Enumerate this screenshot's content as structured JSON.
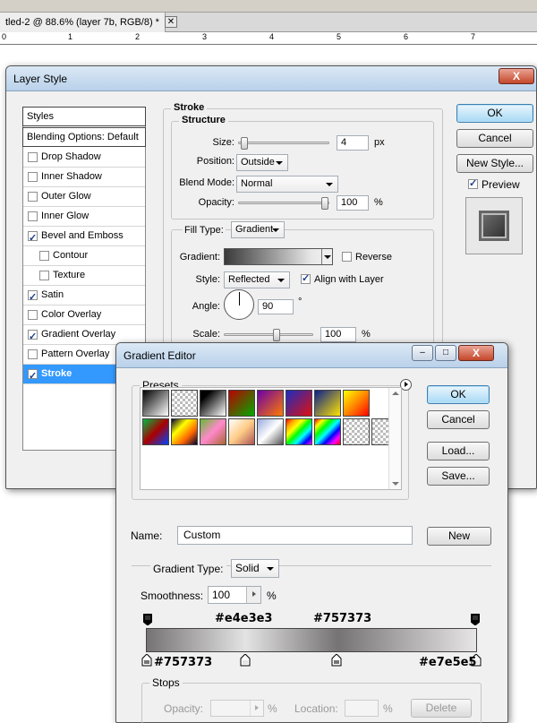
{
  "document": {
    "tab_title": "tled-2 @ 88.6% (layer 7b, RGB/8) *",
    "close_glyph": "✕",
    "ruler_numbers": [
      "0",
      "1",
      "2",
      "3",
      "4",
      "5",
      "6",
      "7"
    ]
  },
  "layer_style": {
    "title": "Layer Style",
    "close_glyph": "X",
    "styles_header": "Styles",
    "blending_options": "Blending Options: Default",
    "items": [
      {
        "label": "Drop Shadow",
        "checked": false,
        "indent": false
      },
      {
        "label": "Inner Shadow",
        "checked": false,
        "indent": false
      },
      {
        "label": "Outer Glow",
        "checked": false,
        "indent": false
      },
      {
        "label": "Inner Glow",
        "checked": false,
        "indent": false
      },
      {
        "label": "Bevel and Emboss",
        "checked": true,
        "indent": false
      },
      {
        "label": "Contour",
        "checked": false,
        "indent": true
      },
      {
        "label": "Texture",
        "checked": false,
        "indent": true
      },
      {
        "label": "Satin",
        "checked": true,
        "indent": false
      },
      {
        "label": "Color Overlay",
        "checked": false,
        "indent": false
      },
      {
        "label": "Gradient Overlay",
        "checked": true,
        "indent": false
      },
      {
        "label": "Pattern Overlay",
        "checked": false,
        "indent": false
      },
      {
        "label": "Stroke",
        "checked": true,
        "indent": false,
        "selected": true
      }
    ],
    "stroke": {
      "section_title": "Stroke",
      "structure_title": "Structure",
      "size_label": "Size:",
      "size_value": "4",
      "size_unit": "px",
      "size_fraction": 0.02,
      "position_label": "Position:",
      "position_value": "Outside",
      "blend_label": "Blend Mode:",
      "blend_value": "Normal",
      "opacity_label": "Opacity:",
      "opacity_value": "100",
      "opacity_unit": "%",
      "opacity_fraction": 1.0,
      "fill_type_label": "Fill Type:",
      "fill_type_value": "Gradient",
      "gradient_label": "Gradient:",
      "reverse_label": "Reverse",
      "reverse_checked": false,
      "style_label": "Style:",
      "style_value": "Reflected",
      "align_label": "Align with Layer",
      "align_checked": true,
      "angle_label": "Angle:",
      "angle_value": "90",
      "angle_unit": "°",
      "scale_label": "Scale:",
      "scale_value": "100",
      "scale_unit": "%",
      "scale_fraction": 0.6
    },
    "buttons": {
      "ok": "OK",
      "cancel": "Cancel",
      "new_style": "New Style...",
      "preview_label": "Preview",
      "preview_checked": true
    }
  },
  "gradient_editor": {
    "title": "Gradient Editor",
    "presets_label": "Presets",
    "buttons": {
      "ok": "OK",
      "cancel": "Cancel",
      "load": "Load...",
      "save": "Save...",
      "new": "New",
      "delete": "Delete"
    },
    "name_label": "Name:",
    "name_value": "Custom",
    "gradient_type_label": "Gradient Type:",
    "gradient_type_value": "Solid",
    "smoothness_label": "Smoothness:",
    "smoothness_value": "100",
    "smoothness_unit": "%",
    "stop_labels": {
      "top_left": "#e4e3e3",
      "top_right": "#757373",
      "bottom_left": "#757373",
      "bottom_right": "#e7e5e5"
    },
    "stops_title": "Stops",
    "opacity_label": "Opacity:",
    "opacity_unit": "%",
    "location_label": "Location:",
    "location_unit": "%"
  }
}
